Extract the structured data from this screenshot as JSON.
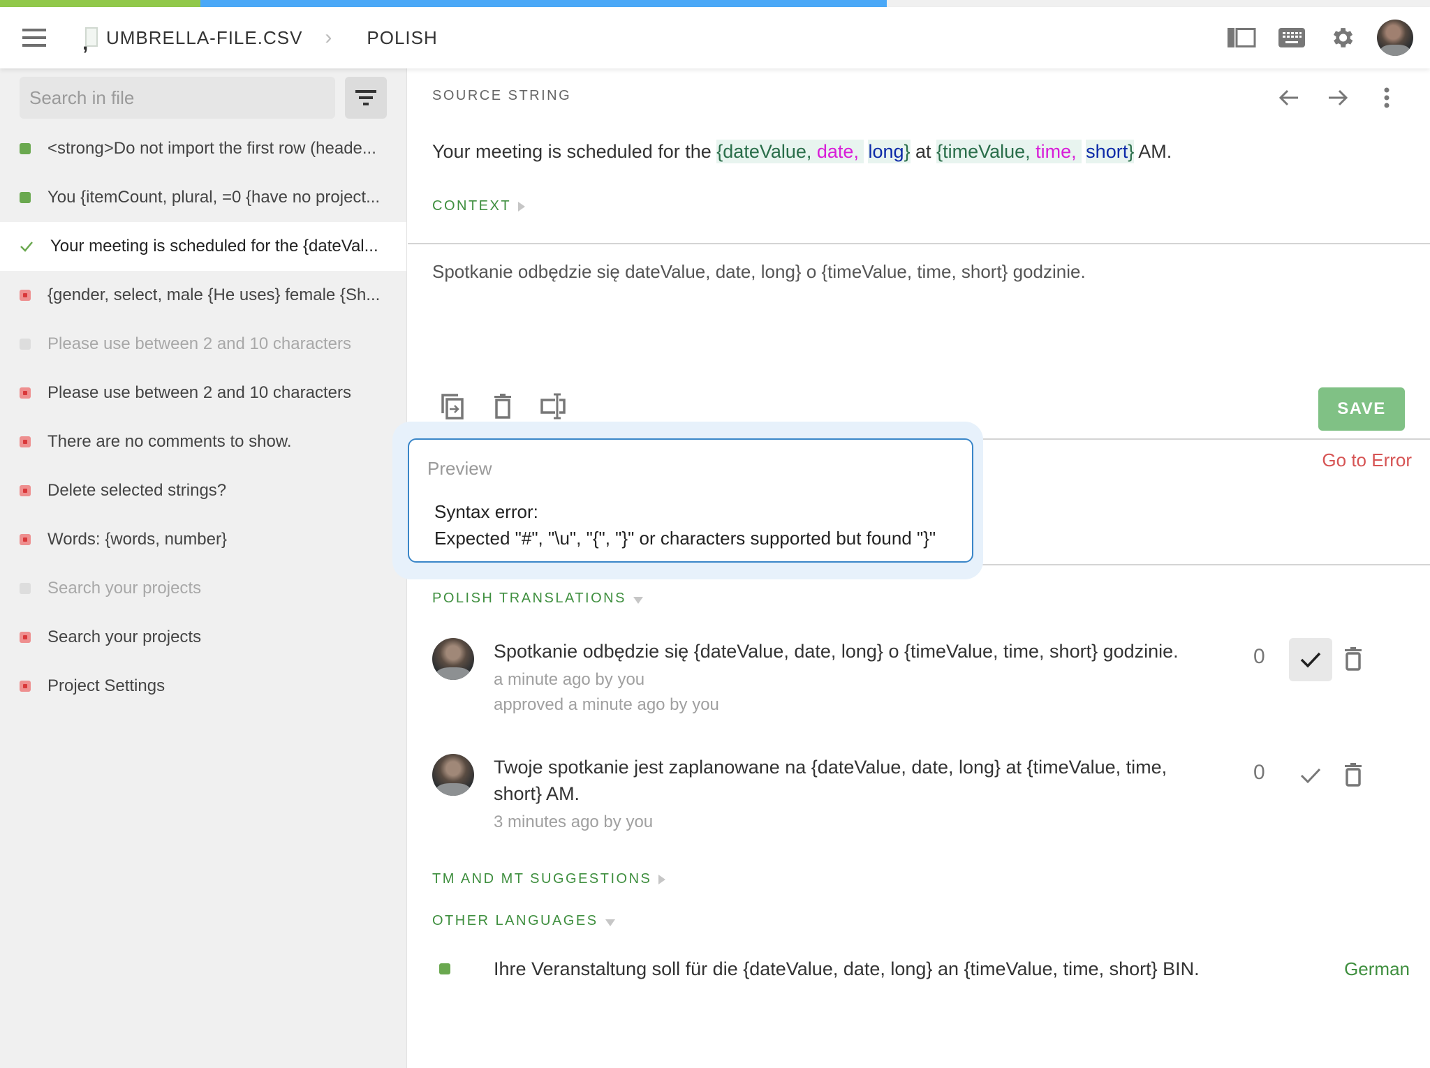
{
  "progress": {
    "approved_fraction": 0.14,
    "translated_fraction": 0.48
  },
  "header": {
    "file_name": "UMBRELLA-FILE.CSV",
    "language": "POLISH",
    "icons": [
      "sidebar-toggle-icon",
      "keyboard-icon",
      "gear-icon",
      "user-avatar"
    ]
  },
  "sidebar": {
    "search_placeholder": "Search in file",
    "search_value": "",
    "strings": [
      {
        "text": "<strong>Do not import the first row (heade...",
        "status": "approved"
      },
      {
        "text": "You {itemCount, plural, =0 {have no project...",
        "status": "approved"
      },
      {
        "text": "Your meeting is scheduled for the {dateVal...",
        "status": "check",
        "active": true
      },
      {
        "text": "{gender, select, male {He uses} female {Sh...",
        "status": "error"
      },
      {
        "text": "Please use between 2 and 10 characters",
        "status": "untranslated"
      },
      {
        "text": "Please use between 2 and 10 characters",
        "status": "error"
      },
      {
        "text": "There are no comments to show.",
        "status": "error"
      },
      {
        "text": "Delete selected strings?",
        "status": "error"
      },
      {
        "text": "Words: {words, number}",
        "status": "error"
      },
      {
        "text": "Search your projects",
        "status": "untranslated"
      },
      {
        "text": "Search your projects",
        "status": "error"
      },
      {
        "text": "Project Settings",
        "status": "error"
      }
    ]
  },
  "source": {
    "label": "SOURCE STRING",
    "text_before": "Your meeting is scheduled for the ",
    "ph1": {
      "open": "{dateValue, ",
      "format": "date, ",
      "style": "long",
      "close": "}"
    },
    "text_middle": " at ",
    "ph2": {
      "open": "{timeValue, ",
      "format": "time, ",
      "style": "short",
      "close": "}"
    },
    "text_after": " AM.",
    "context_label": "CONTEXT"
  },
  "editor": {
    "value": "Spotkanie odbędzie się dateValue, date, long} o {timeValue, time, short} godzinie.",
    "tools": [
      "copy-source-icon",
      "clear-icon",
      "insert-placeholder-icon"
    ],
    "save_label": "SAVE",
    "goto_error_label": "Go to Error"
  },
  "preview": {
    "title": "Preview",
    "line1": "Syntax error:",
    "line2": "Expected \"#\", \"\\u\", \"{\", \"}\" or characters supported but found \"}\""
  },
  "translations": {
    "label": "POLISH TRANSLATIONS",
    "items": [
      {
        "text": "Spotkanie odbędzie się {dateValue, date, long} o {timeValue, time, short} godzinie.",
        "meta": [
          "a minute ago by you",
          "approved a minute ago by you"
        ],
        "votes": "0",
        "approved": true
      },
      {
        "text": "Twoje spotkanie jest zaplanowane na {dateValue, date, long} at {timeValue, time, short} AM.",
        "meta": [
          "3 minutes ago by you"
        ],
        "votes": "0",
        "approved": false
      }
    ]
  },
  "suggestions": {
    "label": "TM AND MT SUGGESTIONS"
  },
  "other_languages": {
    "label": "OTHER LANGUAGES",
    "items": [
      {
        "text": "Ihre Veranstaltung soll für die {dateValue, date, long} an {timeValue, time, short} BIN.",
        "language": "German"
      }
    ]
  },
  "colors": {
    "approved": "#6aa84f",
    "error": "#ee8f8f",
    "untranslated": "#dddddd",
    "accent_green": "#3f8f3f",
    "save": "#80c185",
    "error_link": "#d65454",
    "preview_border": "#3a86c8"
  }
}
